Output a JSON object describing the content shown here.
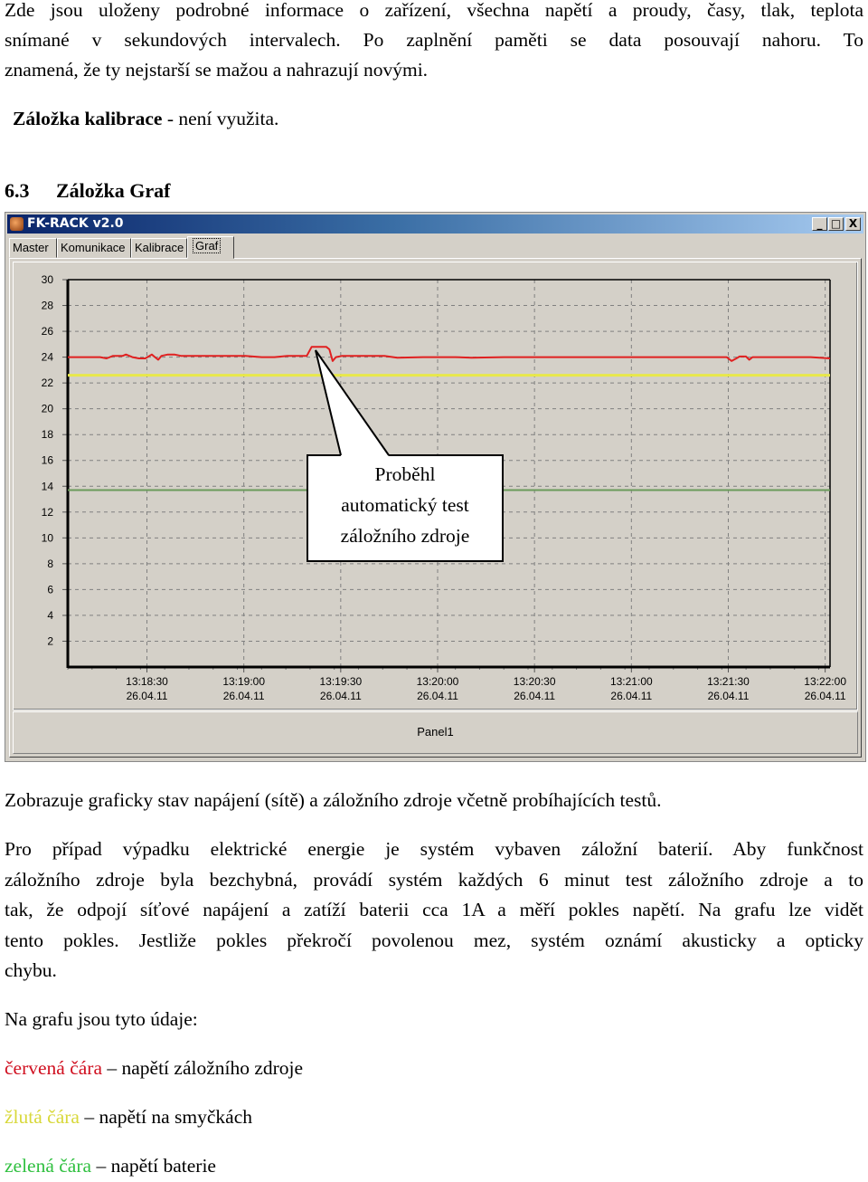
{
  "intro": {
    "line1": "Zde jsou uloženy podrobné informace o zařízení, všechna napětí a proudy, časy, tlak, teplota",
    "line2": "snímané v sekundových intervalech. Po zaplnění paměti se data posouvají nahoru. To",
    "line3": "znamená, že ty nejstarší se mažou a nahrazují novými."
  },
  "calibration_note": {
    "bold": "Záložka kalibrace",
    "rest": " - není využita."
  },
  "section": {
    "number": "6.3",
    "title": "Záložka Graf"
  },
  "window": {
    "title": "FK-RACK  v2.0",
    "buttons": {
      "minimize": "_",
      "maximize": "□",
      "close": "X"
    },
    "tabs": [
      {
        "label": "Master"
      },
      {
        "label": "Komunikace"
      },
      {
        "label": "Kalibrace"
      },
      {
        "label": "Graf",
        "active": true
      }
    ],
    "panel_label": "Panel1",
    "callout": {
      "line1": "Proběhl",
      "line2": "automatický test",
      "line3": "záložního zdroje"
    }
  },
  "chart_data": {
    "type": "line",
    "title": "",
    "xlabel": "",
    "ylabel": "",
    "ylim": [
      0,
      30
    ],
    "yticks": [
      2,
      4,
      6,
      8,
      10,
      12,
      14,
      16,
      18,
      20,
      22,
      24,
      26,
      28,
      30
    ],
    "xlim_seconds": [
      0,
      236
    ],
    "xticks": [
      {
        "t": 24.5,
        "time": "13:18:30",
        "date": "26.04.11"
      },
      {
        "t": 54.5,
        "time": "13:19:00",
        "date": "26.04.11"
      },
      {
        "t": 84.5,
        "time": "13:19:30",
        "date": "26.04.11"
      },
      {
        "t": 114.5,
        "time": "13:20:00",
        "date": "26.04.11"
      },
      {
        "t": 144.5,
        "time": "13:20:30",
        "date": "26.04.11"
      },
      {
        "t": 174.5,
        "time": "13:21:00",
        "date": "26.04.11"
      },
      {
        "t": 204.5,
        "time": "13:21:30",
        "date": "26.04.11"
      },
      {
        "t": 234.5,
        "time": "13:22:00",
        "date": "26.04.11"
      }
    ],
    "grid": true,
    "series": [
      {
        "name": "napětí záložního zdroje",
        "color": "#e02020",
        "points": [
          [
            0,
            24.0
          ],
          [
            10,
            24.0
          ],
          [
            12,
            23.9
          ],
          [
            14,
            24.1
          ],
          [
            17,
            24.1
          ],
          [
            18,
            24.2
          ],
          [
            20,
            24.0
          ],
          [
            22,
            23.9
          ],
          [
            24,
            23.9
          ],
          [
            26,
            24.2
          ],
          [
            27,
            24.0
          ],
          [
            28,
            23.8
          ],
          [
            29,
            24.1
          ],
          [
            31,
            24.2
          ],
          [
            33,
            24.2
          ],
          [
            35,
            24.1
          ],
          [
            45,
            24.1
          ],
          [
            55,
            24.1
          ],
          [
            60,
            24.0
          ],
          [
            64,
            24.0
          ],
          [
            68,
            24.1
          ],
          [
            72,
            24.1
          ],
          [
            74,
            24.1
          ],
          [
            75.5,
            24.8
          ],
          [
            80,
            24.8
          ],
          [
            81,
            24.6
          ],
          [
            82,
            23.7
          ],
          [
            83,
            24.0
          ],
          [
            85,
            24.1
          ],
          [
            92,
            24.1
          ],
          [
            98,
            24.1
          ],
          [
            102,
            23.95
          ],
          [
            110,
            24.0
          ],
          [
            120,
            24.0
          ],
          [
            125,
            23.95
          ],
          [
            135,
            24.0
          ],
          [
            150,
            24.0
          ],
          [
            165,
            24.0
          ],
          [
            175,
            24.0
          ],
          [
            190,
            24.0
          ],
          [
            204,
            24.0
          ],
          [
            205.5,
            23.7
          ],
          [
            207,
            23.9
          ],
          [
            208,
            24.05
          ],
          [
            210,
            24.05
          ],
          [
            211,
            23.8
          ],
          [
            212,
            24.0
          ],
          [
            220,
            24.0
          ],
          [
            230,
            24.0
          ],
          [
            236,
            23.9
          ]
        ]
      },
      {
        "name": "napětí na smyčkách",
        "color": "#e8e84a",
        "points": [
          [
            0,
            22.6
          ],
          [
            236,
            22.6
          ]
        ]
      },
      {
        "name": "napětí baterie",
        "color": "#6a9a5a",
        "points": [
          [
            0,
            13.7
          ],
          [
            236,
            13.7
          ]
        ]
      }
    ],
    "annotation": "Proběhl automatický test záložního zdroje"
  },
  "description": "Zobrazuje graficky stav napájení (sítě) a záložního zdroje včetně probíhajících testů.",
  "paragraph": {
    "line1": "Pro případ výpadku elektrické energie je systém vybaven záložní baterií. Aby funkčnost",
    "line2": "záložního zdroje byla bezchybná, provádí systém každých 6 minut test záložního zdroje a to",
    "line3": "tak, že odpojí síťové napájení a zatíží baterii cca 1A a měří pokles napětí. Na grafu lze vidět",
    "line4": "tento pokles. Jestliže pokles překročí povolenou mez, systém oznámí akusticky a opticky",
    "line5": "chybu."
  },
  "legend_intro": "Na grafu jsou tyto údaje:",
  "legend": [
    {
      "color_word": "červená čára",
      "rest": " – napětí záložního zdroje",
      "color": "#d01020"
    },
    {
      "color_word": "žlutá čára",
      "rest": " – napětí na smyčkách",
      "color": "#d8d83a"
    },
    {
      "color_word": "zelená čára",
      "rest": " – napětí baterie",
      "color": "#30c040"
    }
  ]
}
